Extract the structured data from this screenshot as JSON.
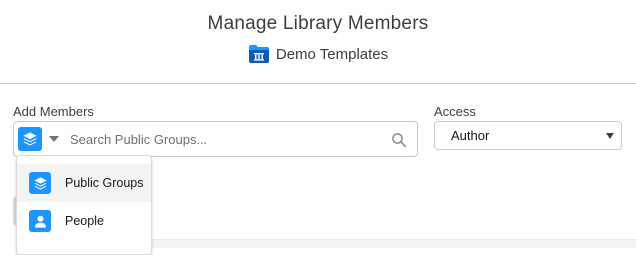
{
  "header": {
    "title": "Manage Library Members",
    "library_name": "Demo Templates"
  },
  "add_members": {
    "label": "Add Members",
    "search_placeholder": "Search Public Groups...",
    "selected_type_icon": "public-groups-icon",
    "dropdown_items": [
      {
        "label": "Public Groups",
        "icon": "public-groups-icon"
      },
      {
        "label": "People",
        "icon": "person-icon"
      }
    ]
  },
  "access": {
    "label": "Access",
    "value": "Author"
  },
  "colors": {
    "accent": "#1b96ff",
    "folder_icon": "#0b5cab"
  }
}
